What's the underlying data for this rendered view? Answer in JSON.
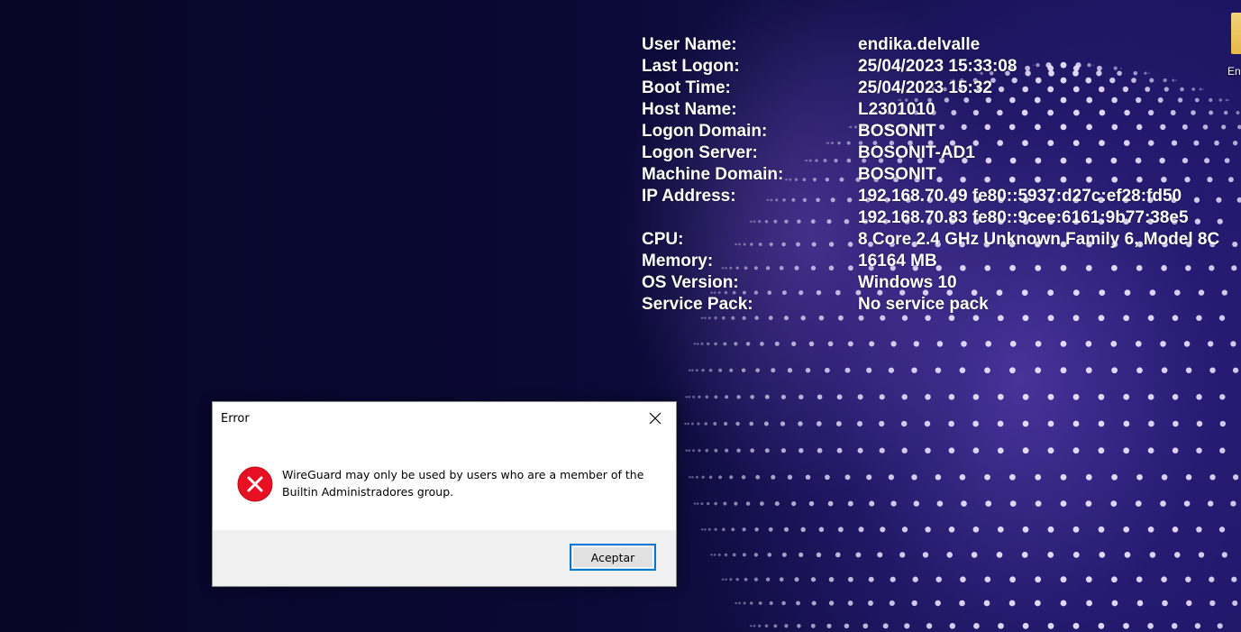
{
  "desktop": {
    "icon_label": "En"
  },
  "bginfo": {
    "rows": [
      {
        "label": "User Name:",
        "value": "endika.delvalle"
      },
      {
        "label": "Last Logon:",
        "value": "25/04/2023 15:33:08"
      },
      {
        "label": "Boot Time:",
        "value": "25/04/2023 15:32"
      },
      {
        "label": "Host Name:",
        "value": "L2301010"
      },
      {
        "label": "Logon Domain:",
        "value": "BOSONIT"
      },
      {
        "label": "Logon Server:",
        "value": "BOSONIT-AD1"
      },
      {
        "label": "Machine Domain:",
        "value": "BOSONIT"
      },
      {
        "label": "IP Address:",
        "value": "192.168.70.49 fe80::5937:d27c:ef28:fd50"
      },
      {
        "label": "",
        "value": "192.168.70.83 fe80::9cee:6161:9b77:38e5"
      },
      {
        "label": "CPU:",
        "value": "8 Core 2.4 GHz Unknown Family 6, Model 8C"
      },
      {
        "label": "Memory:",
        "value": "16164 MB"
      },
      {
        "label": "OS Version:",
        "value": "Windows 10"
      },
      {
        "label": "Service Pack:",
        "value": "No service pack"
      }
    ]
  },
  "dialog": {
    "title": "Error",
    "message": "WireGuard may only be used by users who are a member of the Builtin Administradores group.",
    "ok_label": "Aceptar",
    "icon": "error-icon",
    "close_icon": "close-icon"
  },
  "colors": {
    "accent": "#0078d7",
    "error_red": "#e81123"
  }
}
